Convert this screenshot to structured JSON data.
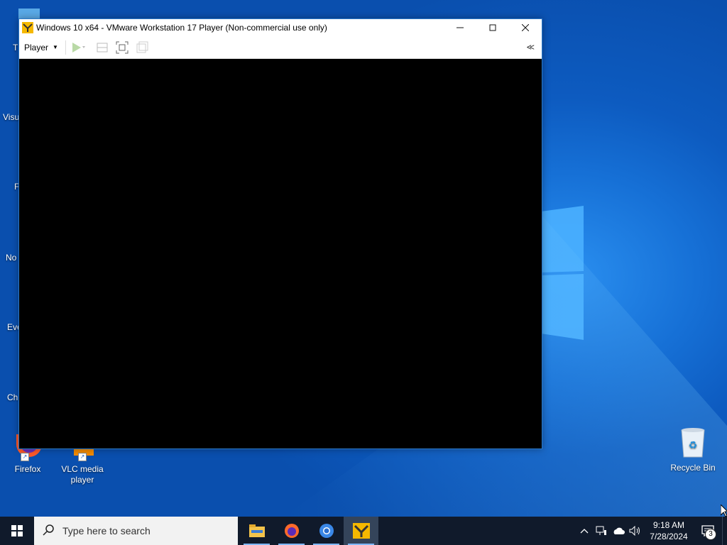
{
  "desktop": {
    "icons_left": [
      {
        "label": "T",
        "icon": "this-pc-icon"
      },
      {
        "label": "Visu",
        "icon": "visual-studio-icon"
      },
      {
        "label": "F",
        "icon": "firefox-icon"
      },
      {
        "label": "No",
        "icon": "notepad-icon"
      },
      {
        "label": "Eve",
        "icon": "everything-icon"
      },
      {
        "label": "Ch",
        "icon": "chrome-icon"
      }
    ],
    "firefox_label": "Firefox",
    "vlc_label_line1": "VLC media",
    "vlc_label_line2": "player",
    "recycle_bin_label": "Recycle Bin"
  },
  "vmware": {
    "title": "Windows 10 x64 - VMware Workstation 17 Player (Non-commercial use only)",
    "player_menu_label": "Player",
    "collapse_label": "≪"
  },
  "taskbar": {
    "search_placeholder": "Type here to search",
    "time": "9:18 AM",
    "date": "7/28/2024",
    "notification_count": "3",
    "apps": [
      "file-explorer-icon",
      "firefox-icon",
      "chrome-icon",
      "vmware-icon"
    ]
  },
  "colors": {
    "accent": "#0d5bc0",
    "taskbar": "#101a2b",
    "vm_screen": "#000000"
  }
}
